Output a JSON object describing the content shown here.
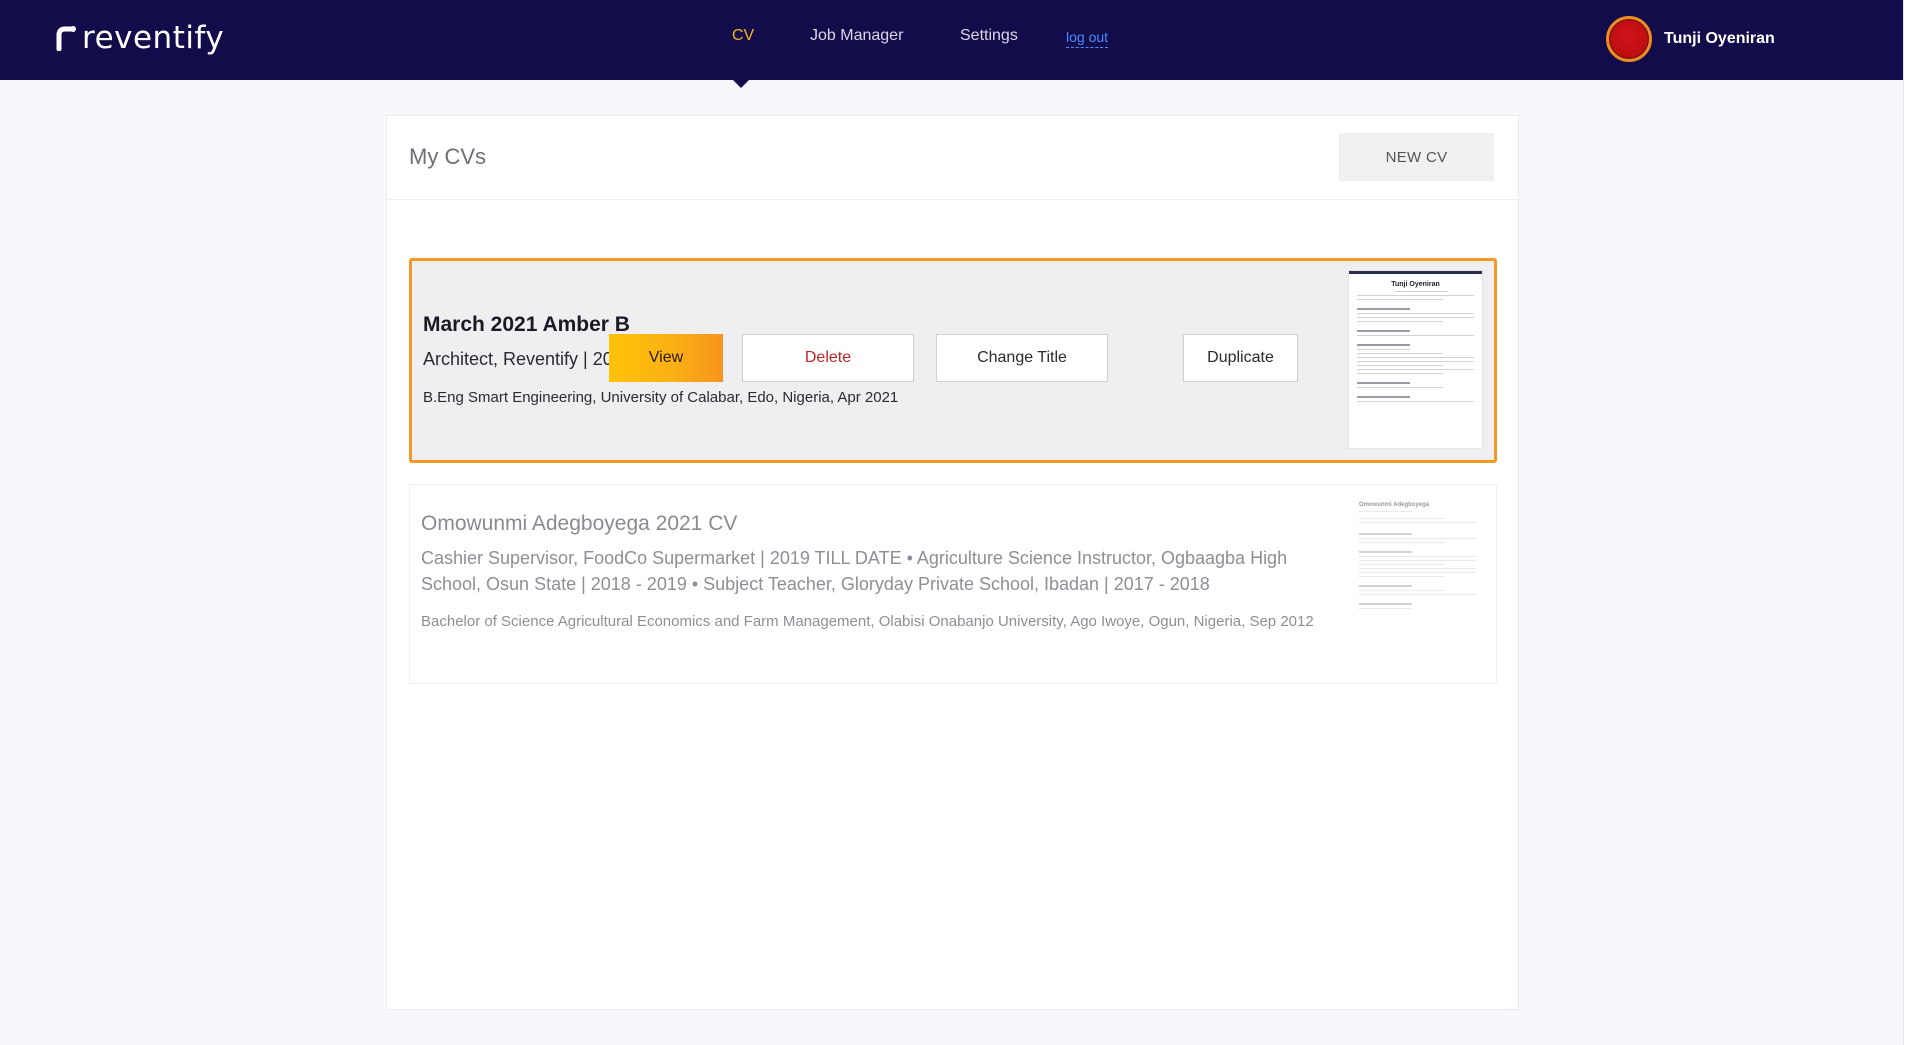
{
  "brand": {
    "name": "reventify"
  },
  "nav": {
    "items": [
      {
        "label": "CV",
        "active": true
      },
      {
        "label": "Job Manager",
        "active": false
      },
      {
        "label": "Settings",
        "active": false
      }
    ],
    "logout_label": "log out"
  },
  "user": {
    "name": "Tunji Oyeniran"
  },
  "panel": {
    "title": "My CVs",
    "new_cv_label": "NEW CV"
  },
  "cvs": [
    {
      "title": "March 2021 Amber B",
      "experience": "Architect, Reventify | 2021",
      "education": "B.Eng Smart Engineering, University of Calabar, Edo, Nigeria, Apr 2021",
      "thumbnail_name": "Tunji Oyeniran",
      "selected": true
    },
    {
      "title": "Omowunmi Adegboyega 2021 CV",
      "experience": "Cashier Supervisor, FoodCo Supermarket | 2019 TILL DATE • Agriculture Science Instructor, Ogbaagba High School, Osun State | 2018 - 2019 • Subject Teacher, Gloryday Private School, Ibadan | 2017 - 2018",
      "education": "Bachelor of Science Agricultural Economics and Farm Management, Olabisi Onabanjo University, Ago Iwoye, Ogun, Nigeria, Sep 2012",
      "thumbnail_name": "Omowunmi Adegboyega",
      "selected": false
    }
  ],
  "actions": {
    "view": "View",
    "delete": "Delete",
    "change_title": "Change Title",
    "duplicate": "Duplicate"
  },
  "colors": {
    "header_bg": "#120c4a",
    "active_nav": "#f5b324",
    "selection_border": "#f39a22",
    "delete_text": "#c0242b",
    "view_gradient_start": "#ffc107",
    "view_gradient_end": "#f7941d"
  }
}
